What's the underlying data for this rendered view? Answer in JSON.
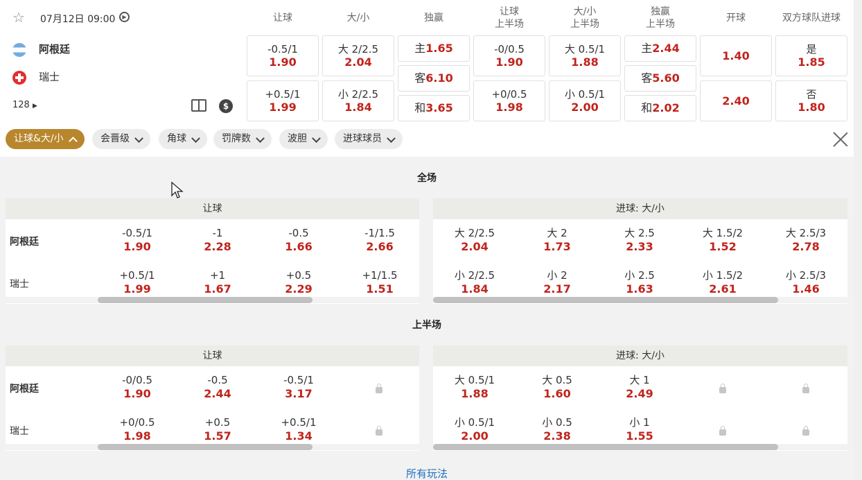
{
  "match": {
    "datetime": "07月12日 09:00",
    "home": "阿根廷",
    "away": "瑞士",
    "more_count": "128"
  },
  "columns": [
    {
      "l1": "让球",
      "l2": ""
    },
    {
      "l1": "大/小",
      "l2": ""
    },
    {
      "l1": "独赢",
      "l2": ""
    },
    {
      "l1": "让球",
      "l2": "上半场"
    },
    {
      "l1": "大/小",
      "l2": "上半场"
    },
    {
      "l1": "独赢",
      "l2": "上半场"
    },
    {
      "l1": "开球",
      "l2": ""
    },
    {
      "l1": "双方球队进球",
      "l2": ""
    }
  ],
  "quick": {
    "hdp": [
      {
        "line": "-0.5/1",
        "odds": "1.90"
      },
      {
        "line": "+0.5/1",
        "odds": "1.99"
      }
    ],
    "ou": [
      {
        "line": "大 2/2.5",
        "odds": "2.04"
      },
      {
        "line": "小 2/2.5",
        "odds": "1.84"
      }
    ],
    "moneyline": [
      {
        "pre": "主",
        "odds": "1.65"
      },
      {
        "pre": "客",
        "odds": "6.10"
      },
      {
        "pre": "和",
        "odds": "3.65"
      }
    ],
    "hdp_1h": [
      {
        "line": "-0/0.5",
        "odds": "1.90"
      },
      {
        "line": "+0/0.5",
        "odds": "1.98"
      }
    ],
    "ou_1h": [
      {
        "line": "大 0.5/1",
        "odds": "1.88"
      },
      {
        "line": "小 0.5/1",
        "odds": "2.00"
      }
    ],
    "moneyline_1h": [
      {
        "pre": "主",
        "odds": "2.44"
      },
      {
        "pre": "客",
        "odds": "5.60"
      },
      {
        "pre": "和",
        "odds": "2.02"
      }
    ],
    "kickoff": [
      {
        "odds": "1.40"
      },
      {
        "odds": "2.40"
      }
    ],
    "btts": [
      {
        "line": "是",
        "odds": "1.85"
      },
      {
        "line": "否",
        "odds": "1.80"
      }
    ]
  },
  "filters": [
    "让球&大/小",
    "会晋级",
    "角球",
    "罚牌数",
    "波胆",
    "进球球员"
  ],
  "sections": {
    "full": {
      "title": "全场",
      "hdp_title": "让球",
      "ou_title": "进球: 大/小",
      "hdp_home": [
        {
          "l": "-0.5/1",
          "o": "1.90"
        },
        {
          "l": "-1",
          "o": "2.28"
        },
        {
          "l": "-0.5",
          "o": "1.66"
        },
        {
          "l": "-1/1.5",
          "o": "2.66"
        }
      ],
      "hdp_away": [
        {
          "l": "+0.5/1",
          "o": "1.99"
        },
        {
          "l": "+1",
          "o": "1.67"
        },
        {
          "l": "+0.5",
          "o": "2.29"
        },
        {
          "l": "+1/1.5",
          "o": "1.51"
        }
      ],
      "ou_over": [
        {
          "l": "大 2/2.5",
          "o": "2.04"
        },
        {
          "l": "大 2",
          "o": "1.73"
        },
        {
          "l": "大 2.5",
          "o": "2.33"
        },
        {
          "l": "大 1.5/2",
          "o": "1.52"
        },
        {
          "l": "大 2.5/3",
          "o": "2.78"
        }
      ],
      "ou_under": [
        {
          "l": "小 2/2.5",
          "o": "1.84"
        },
        {
          "l": "小 2",
          "o": "2.17"
        },
        {
          "l": "小 2.5",
          "o": "1.63"
        },
        {
          "l": "小 1.5/2",
          "o": "2.61"
        },
        {
          "l": "小 2.5/3",
          "o": "1.46"
        }
      ]
    },
    "half": {
      "title": "上半场",
      "hdp_title": "让球",
      "ou_title": "进球: 大/小",
      "hdp_home": [
        {
          "l": "-0/0.5",
          "o": "1.90"
        },
        {
          "l": "-0.5",
          "o": "2.44"
        },
        {
          "l": "-0.5/1",
          "o": "3.17"
        }
      ],
      "hdp_away": [
        {
          "l": "+0/0.5",
          "o": "1.98"
        },
        {
          "l": "+0.5",
          "o": "1.57"
        },
        {
          "l": "+0.5/1",
          "o": "1.34"
        }
      ],
      "ou_over": [
        {
          "l": "大 0.5/1",
          "o": "1.88"
        },
        {
          "l": "大 0.5",
          "o": "1.60"
        },
        {
          "l": "大 1",
          "o": "2.49"
        }
      ],
      "ou_under": [
        {
          "l": "小 0.5/1",
          "o": "2.00"
        },
        {
          "l": "小 0.5",
          "o": "2.38"
        },
        {
          "l": "小 1",
          "o": "1.55"
        }
      ]
    }
  },
  "all_markets_link": "所有玩法",
  "icons": [
    "star-icon",
    "live-icon",
    "flag-argentina-icon",
    "flag-switzerland-icon",
    "chevron-right-icon",
    "pitch-icon",
    "coin-icon",
    "chevron-down-icon",
    "close-icon",
    "lock-icon",
    "cursor-icon"
  ],
  "colors": {
    "odds": "#c0241c",
    "active_filter": "#b8862c",
    "link": "#1e6fc0"
  }
}
